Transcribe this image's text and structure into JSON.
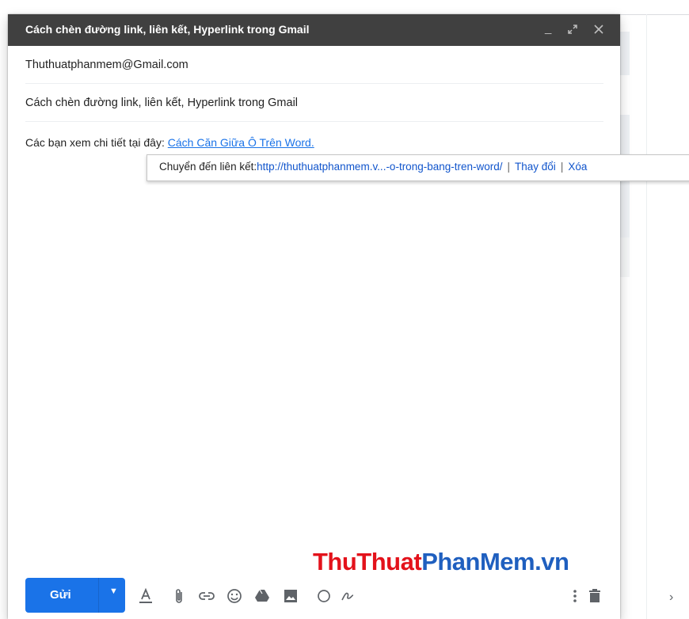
{
  "compose": {
    "title": "Cách chèn đường link, liên kết, Hyperlink trong Gmail",
    "to": "Thuthuatphanmem@Gmail.com",
    "subject": "Cách chèn đường link, liên kết, Hyperlink trong Gmail",
    "body_prefix": "Các bạn xem chi tiết tại đây: ",
    "body_link": "Cách Căn Giữa Ô Trên Word."
  },
  "header_icons": [
    "minimize-icon",
    "expand-icon",
    "close-icon"
  ],
  "tooltip": {
    "label": "Chuyển đến liên kết:",
    "url": "http://thuthuatphanmem.v...-o-trong-bang-tren-word/",
    "separator": "|",
    "change": "Thay đổi",
    "remove": "Xóa"
  },
  "toolbar": {
    "send_label": "Gửi",
    "icons": [
      "formatting-icon",
      "attach-icon",
      "link-icon",
      "emoji-icon",
      "drive-icon",
      "photo-icon",
      "confidential-icon",
      "signature-icon",
      "more-options-icon",
      "delete-icon"
    ]
  },
  "watermark": {
    "part1": "ThuThuat",
    "part2": "PhanMem.vn"
  },
  "colors": {
    "header_bg": "#404040",
    "send_button": "#1a73e8",
    "link": "#1a73e8",
    "watermark_red": "#e3121b",
    "watermark_blue": "#1f5fbf"
  }
}
